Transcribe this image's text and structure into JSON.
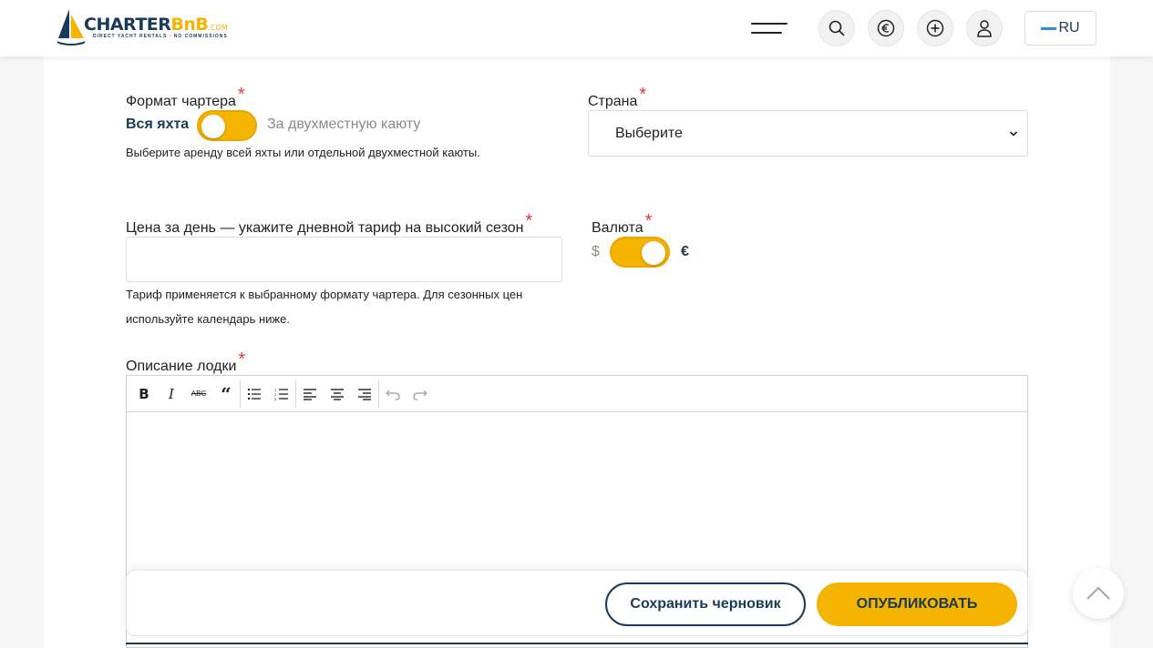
{
  "header": {
    "logo": {
      "name": "CHARTER",
      "name_accent": "BnB",
      "suffix": ".COM",
      "tagline": "DIRECT YACHT RENTALS · NO COMMISSIONS"
    },
    "icons": [
      "menu-icon",
      "search-icon",
      "euro-icon",
      "plus-circle-icon",
      "user-icon"
    ],
    "language": "RU"
  },
  "form": {
    "charter_format": {
      "label": "Формат чартера",
      "required_mark": "*",
      "option_left": "Вся яхта",
      "option_right": "За двухместную каюту",
      "selected": "Вся яхта",
      "help": "Выберите аренду всей яхты или отдельной двухместной каюты."
    },
    "country": {
      "label": "Страна",
      "required_mark": "*",
      "value": "Выберите"
    },
    "price": {
      "label": "Цена за день — укажите дневной тариф на высокий сезон",
      "required_mark": "*",
      "value": "",
      "help_line1": "Тариф применяется к выбранному формату чартера. Для сезонных цен",
      "help_line2": "используйте календарь ниже."
    },
    "currency": {
      "label": "Валюта",
      "required_mark": "*",
      "option_left": "$",
      "option_right": "€",
      "selected": "€"
    },
    "description": {
      "label": "Описание лодки",
      "required_mark": "*",
      "toolbar": [
        "bold-icon",
        "italic-icon",
        "strikethrough-icon",
        "quote-icon",
        "bullet-list-icon",
        "numbered-list-icon",
        "align-left-icon",
        "align-center-icon",
        "align-right-icon",
        "undo-icon",
        "redo-icon"
      ],
      "value": ""
    }
  },
  "actions": {
    "save_draft": "Сохранить черновик",
    "publish": "ОПУБЛИКОВАТЬ"
  },
  "colors": {
    "accent": "#f5b400",
    "navy": "#1b3a57",
    "required": "#e53935"
  }
}
